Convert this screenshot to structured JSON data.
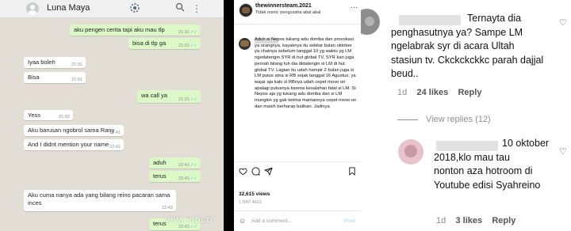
{
  "whatsapp": {
    "contact_name": "Luna Maya",
    "watermark": "VIVA.VIDEO",
    "messages": [
      {
        "dir": "out",
        "text": "aku pengen cerita tapi aku mau tlp",
        "time": "21:01",
        "tick": "✓✓"
      },
      {
        "dir": "out",
        "text": "bisa di tlp ga",
        "time": "21:01",
        "tick": "✓✓"
      },
      {
        "dir": "in",
        "text": "Iyaa boleh",
        "time": "21:01"
      },
      {
        "dir": "in",
        "text": "Bisa",
        "time": "21:01"
      },
      {
        "dir": "out",
        "text": "wa call ya",
        "time": "21:01",
        "tick": "✓✓"
      },
      {
        "dir": "in",
        "text": "Yess",
        "time": "21:02"
      },
      {
        "dir": "in",
        "text": "Aku barusan ngobrol sama Rany",
        "time": "22:41"
      },
      {
        "dir": "in",
        "text": "And I didnt mention your name",
        "time": "22:41"
      },
      {
        "dir": "out",
        "text": "aduh",
        "time": "22:41",
        "tick": "✓✓"
      },
      {
        "dir": "out",
        "text": "terus",
        "time": "22:41",
        "tick": "✓✓"
      },
      {
        "dir": "in",
        "text": "Aku cuma nanya ada yang bilang reino pacaran sama inces",
        "time": "22:42"
      },
      {
        "dir": "out",
        "text": "terus",
        "time": "22:42",
        "tick": "✓✓"
      }
    ]
  },
  "instagram": {
    "username": "thewinnersteam.2021",
    "subtitle": "Tidak resmi: pengusaha abal abal",
    "more": "···",
    "caption": "Aduh si Nepos tukang adu domba dan provokasi ya orangnya, kayaknya itu sekitar bulan oktober ya chatnya sebelum tanggal 10 yg waktu yg LM ngedatengin SYR di hut global TV, SYR kan juga pernah bilang tuh dia didatengin si LM di hut global TV. Lagian itu udah hampir 2 bulan juga si LM putus ama si RB sejak tanggal 16 Agustus, ya wajar aja kalo si RBnya udah cepet move on apalagi putusnya karena kesalahan fatal si LM. Si Nepos aja yg tukang adu domba dan si LM mungkin yg gak terima mantannya cepet move on dan masih berharap balikan. Jadinya",
    "likes": "32,615 views",
    "time": "1 DAY AGO",
    "add_comment": "Add a comment...",
    "post": "Post"
  },
  "comments": [
    {
      "text": "Ternayta dia\npenghasutnya ya? Sampe LM\nngelabrak syr di acara Ultah\nstasiun tv. Ckckckckkc parah dajjal\nbeud..",
      "age": "1d",
      "likes": "24 likes",
      "reply": "Reply"
    },
    {
      "text": "10 oktober\n2018,klo mau tau\nnonton aza hotroom di\nYoutube edisi Syahreino",
      "age": "1d",
      "likes": "3 likes",
      "reply": "Reply"
    }
  ],
  "view_replies": "View replies (12)",
  "icons": {
    "search": "search-icon",
    "menu": "menu-icon",
    "heart": "heart-icon",
    "comment": "comment-icon",
    "share": "share-icon",
    "bookmark": "bookmark-icon",
    "emoji": "emoji-icon"
  }
}
